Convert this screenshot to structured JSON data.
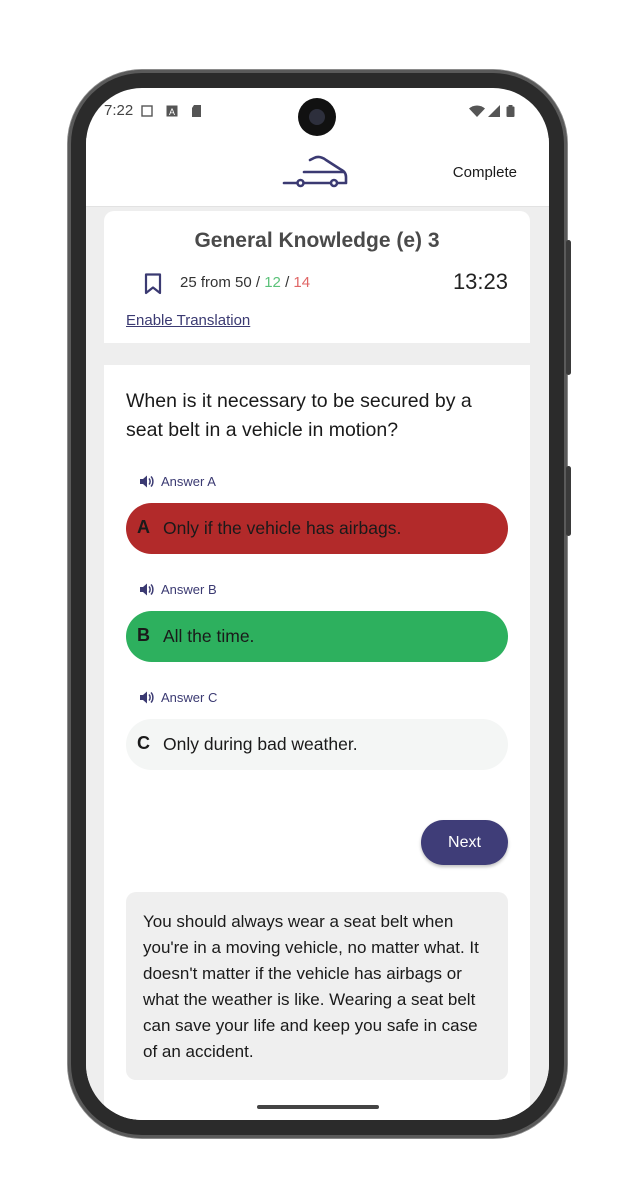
{
  "status_bar": {
    "time": "7:22"
  },
  "header": {
    "complete_label": "Complete"
  },
  "quiz": {
    "title": "General Knowledge (e) 3",
    "progress_prefix": "25 from 50 /",
    "correct_count": "12",
    "separator": "/",
    "wrong_count": "14",
    "timer": "13:23",
    "translation_link": "Enable Translation"
  },
  "question": {
    "text": "When is it necessary to be secured by a seat belt in a vehicle in motion?",
    "answers": [
      {
        "label": "Answer A",
        "letter": "A",
        "text": "Only if the vehicle has airbags.",
        "state": "wrong"
      },
      {
        "label": "Answer B",
        "letter": "B",
        "text": "All the time.",
        "state": "correct"
      },
      {
        "label": "Answer C",
        "letter": "C",
        "text": "Only during bad weather.",
        "state": "neutral"
      }
    ],
    "next_label": "Next",
    "explanation": "You should always wear a seat belt when you're in a moving vehicle, no matter what. It doesn't matter if the vehicle has airbags or what the weather is like. Wearing a seat belt can save your life and keep you safe in case of an accident."
  },
  "colors": {
    "accent": "#3f3d78",
    "wrong": "#b22a2a",
    "correct": "#2db05e",
    "neutral": "#f4f6f5"
  },
  "icons": [
    "truck-logo-icon",
    "bookmark-icon",
    "speaker-icon",
    "wifi-icon",
    "signal-icon",
    "battery-icon"
  ]
}
